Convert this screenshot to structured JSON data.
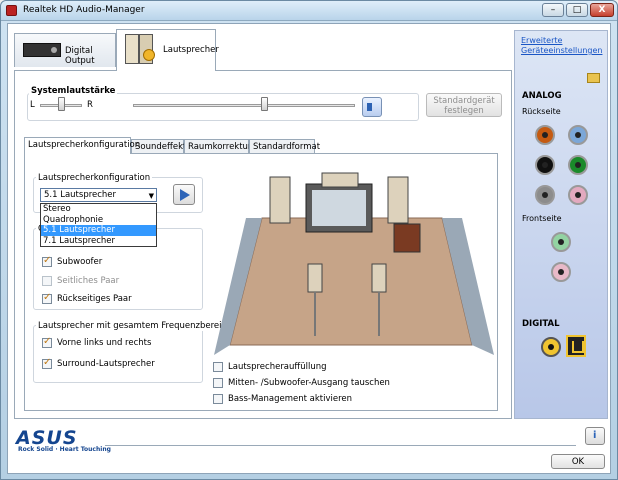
{
  "window": {
    "title": "Realtek HD Audio-Manager",
    "minimize": "–",
    "maximize": "□",
    "close": "X"
  },
  "tabs": [
    {
      "label": "Digital Output"
    },
    {
      "label": "Lautsprecher"
    }
  ],
  "right_panel": {
    "link": [
      "Erweiterte",
      "Geräteeinstellungen"
    ],
    "analog": "ANALOG",
    "rueckseite": "Rückseite",
    "frontseite": "Frontseite",
    "digital": "DIGITAL",
    "back_jacks": [
      {
        "color": "#c55a11"
      },
      {
        "color": "#7ba7d8"
      },
      {
        "color": "#111111"
      },
      {
        "color": "#1a8a2a"
      },
      {
        "color": "#8c8c8c"
      },
      {
        "color": "#e3a9bf"
      }
    ],
    "front_jacks": [
      {
        "color": "#93d3a2"
      },
      {
        "color": "#e8b9c8"
      }
    ]
  },
  "volume": {
    "label": "Systemlautstärke",
    "left": "L",
    "right": "R",
    "balance": 0.5,
    "level": 0.59
  },
  "default_device_button": [
    "Standardgerät",
    "festlegen"
  ],
  "inner_tabs": [
    {
      "label": "Lautsprecherkonfiguration"
    },
    {
      "label": "Soundeffekt"
    },
    {
      "label": "Raumkorrektur"
    },
    {
      "label": "Standardformat"
    }
  ],
  "config": {
    "group_label": "Lautsprecherkonfiguration",
    "selected": "5.1 Lautsprecher",
    "options": [
      "Stereo",
      "Quadrophonie",
      "5.1 Lautsprecher",
      "7.1 Lautsprecher"
    ]
  },
  "optional_group": {
    "group_label": "O",
    "subwoofer": "Subwoofer",
    "side_pair": "Seitliches Paar",
    "rear_pair": "Rückseitiges Paar"
  },
  "fullrange": {
    "group_label": "Lautsprecher mit gesamtem Frequenzbereich",
    "front": "Vorne links und rechts",
    "surround": "Surround-Lautsprecher"
  },
  "options": {
    "fill": "Lautsprecherauffüllung",
    "swap": "Mitten- /Subwoofer-Ausgang tauschen",
    "bass": "Bass-Management aktivieren"
  },
  "brand": {
    "name": "ASUS",
    "tagline": "Rock Solid · Heart Touching"
  },
  "ok": "OK"
}
